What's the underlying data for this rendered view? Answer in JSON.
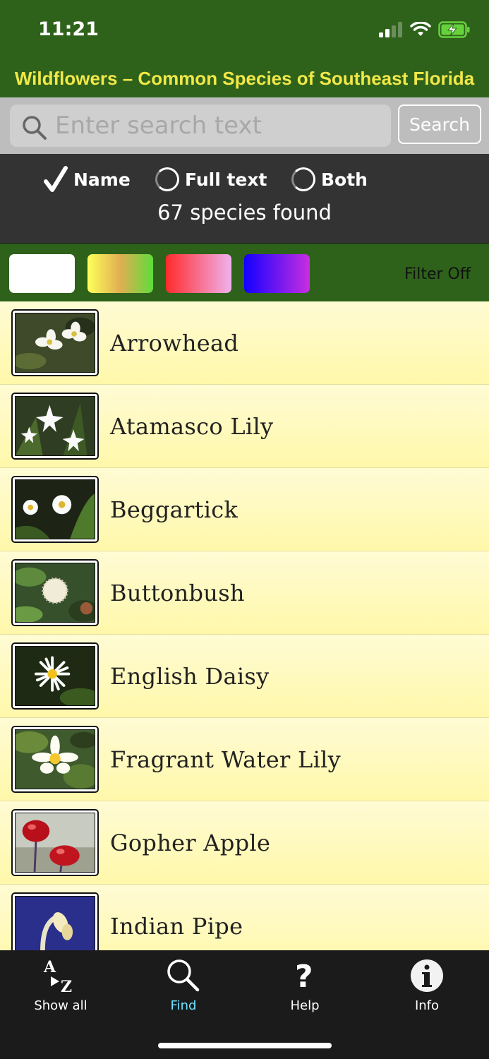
{
  "status": {
    "time": "11:21"
  },
  "app": {
    "title": "Wildflowers – Common Species of Southeast Florida"
  },
  "search": {
    "placeholder": "Enter search text",
    "value": "",
    "button_label": "Search"
  },
  "search_mode": {
    "options": [
      {
        "label": "Name",
        "selected": true
      },
      {
        "label": "Full text",
        "selected": false
      },
      {
        "label": "Both",
        "selected": false
      }
    ],
    "count_text": "67 species found"
  },
  "filter": {
    "swatches": [
      {
        "name": "white",
        "colors": [
          "#ffffff",
          "#ffffff"
        ]
      },
      {
        "name": "yellow-green",
        "colors": [
          "#ffff5a",
          "#e0ae52",
          "#5fdc3c"
        ]
      },
      {
        "name": "red-pink",
        "colors": [
          "#ff2b2b",
          "#f0b2ee"
        ]
      },
      {
        "name": "blue-purple",
        "colors": [
          "#1200ff",
          "#c92ee0"
        ]
      }
    ],
    "status_label": "Filter Off"
  },
  "species": [
    {
      "name": "Arrowhead"
    },
    {
      "name": "Atamasco Lily"
    },
    {
      "name": "Beggartick"
    },
    {
      "name": "Buttonbush"
    },
    {
      "name": "English Daisy"
    },
    {
      "name": "Fragrant Water Lily"
    },
    {
      "name": "Gopher Apple"
    },
    {
      "name": "Indian Pipe"
    }
  ],
  "tabs": [
    {
      "label": "Show all",
      "icon": "a-to-z-icon",
      "active": false
    },
    {
      "label": "Find",
      "icon": "search-icon",
      "active": true
    },
    {
      "label": "Help",
      "icon": "question-icon",
      "active": false
    },
    {
      "label": "Info",
      "icon": "info-icon",
      "active": false
    }
  ],
  "colors": {
    "header_green": "#2e621b",
    "title_yellow": "#f1e848",
    "list_bg": "#fff8aa",
    "active_tab": "#6fe3ff"
  }
}
